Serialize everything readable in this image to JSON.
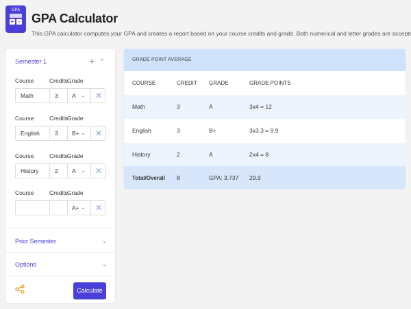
{
  "header": {
    "logo": {
      "top_text": "GPA",
      "keys": [
        "+",
        "-"
      ]
    },
    "title": "GPA Calculator",
    "subtitle": "This GPA calculator computes your GPA and creates a report based on your course credits and grade. Both numerical and letter grades are accepted."
  },
  "left": {
    "semester_title": "Semester 1",
    "plus_icon": "+",
    "caret_up_icon": "^",
    "labels": {
      "course": "Course",
      "credits": "Credits",
      "grade": "Grade"
    },
    "courses": [
      {
        "name": "Math",
        "credit": "3",
        "grade": "A"
      },
      {
        "name": "English",
        "credit": "3",
        "grade": "B+"
      },
      {
        "name": "History",
        "credit": "2",
        "grade": "A"
      },
      {
        "name": "",
        "credit": "",
        "grade": "A+"
      }
    ],
    "chevron_down_icon": "⌄",
    "delete_icon": "✕",
    "prior_semester": "Prior Semester",
    "options": "Options",
    "calculate_label": "Calculate"
  },
  "right": {
    "header": "GRADE POINT AVERAGE",
    "columns": [
      "COURSE",
      "CREDIT",
      "GRADE",
      "GRADE POINTS"
    ],
    "rows": [
      [
        "Math",
        "3",
        "A",
        "3x4 = 12"
      ],
      [
        "English",
        "3",
        "B+",
        "3x3.3 = 9.9"
      ],
      [
        "History",
        "2",
        "A",
        "2x4 = 8"
      ]
    ],
    "total": [
      "Total/Overall",
      "8",
      "GPA: 3.737",
      "29.9"
    ]
  },
  "colors": {
    "accent": "#4a3fd8",
    "table_header_bg": "#cfe1fb",
    "row_alt": "#eef4fd",
    "total_bg": "#d7e6fb",
    "share_icon": "#e8961f"
  }
}
